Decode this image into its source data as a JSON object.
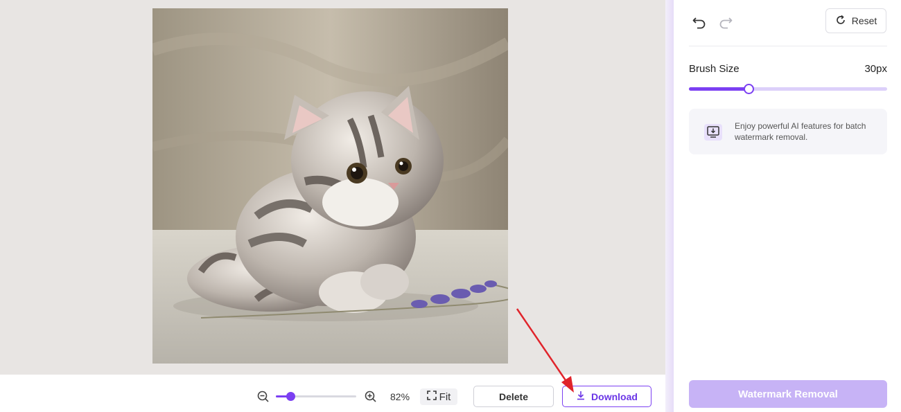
{
  "canvas": {
    "image_alt": "Needle-felted grey tabby kitten lying beside a lavender sprig",
    "zoom": {
      "value": 0.18,
      "label": "82%",
      "zoom_out_icon": "zoom-out-icon",
      "zoom_in_icon": "zoom-in-icon"
    },
    "fit_label": "Fit",
    "fit_icon": "fit-screen-icon",
    "delete_label": "Delete",
    "download_label": "Download",
    "download_icon": "download-icon"
  },
  "panel": {
    "undo_icon": "undo-icon",
    "redo_icon": "redo-icon",
    "reset_label": "Reset",
    "reset_icon": "refresh-icon",
    "brush": {
      "label": "Brush Size",
      "value_text": "30px",
      "fraction": 0.3
    },
    "promo": {
      "icon": "monitor-download-icon",
      "text": "Enjoy powerful AI features for batch watermark removal."
    },
    "action_label": "Watermark Removal"
  },
  "colors": {
    "accent": "#7b3ff2",
    "accent_light": "#c7b3f6",
    "canvas_bg": "#e8e5e3",
    "annotation_arrow": "#e0242b"
  }
}
